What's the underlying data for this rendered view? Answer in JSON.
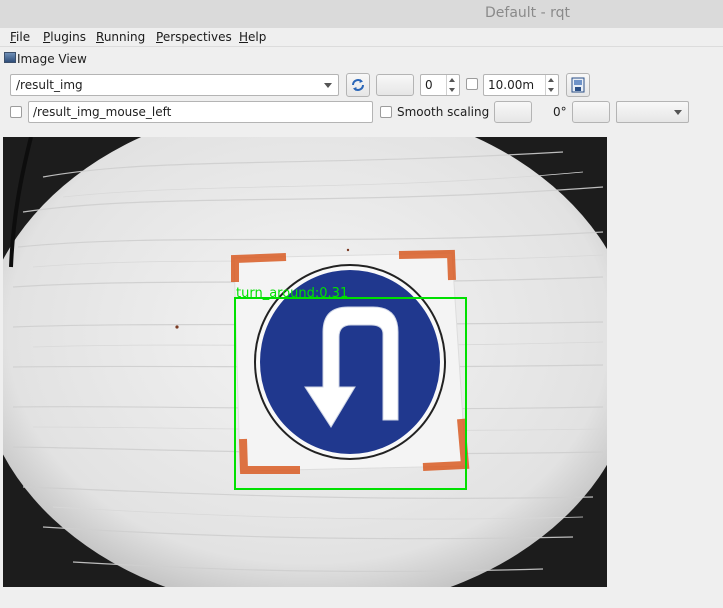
{
  "window": {
    "title": "Default - rqt"
  },
  "menu": {
    "file": "File",
    "plugins": "Plugins",
    "running": "Running",
    "perspectives": "Perspectives",
    "help": "Help"
  },
  "dock": {
    "title": "Image View",
    "icon": "image-view-icon"
  },
  "toolbar": {
    "topic_combo": "/result_img",
    "refresh_icon": "refresh-icon",
    "zoom_value": "0",
    "rate_value": "10.00m",
    "save_icon": "save-image-icon"
  },
  "toolbar2": {
    "mouse_topic": "/result_img_mouse_left",
    "smooth_label": "Smooth scaling",
    "rotation_label": "0°"
  },
  "image": {
    "detection_label": "turn_around:0.31",
    "box_color": "#00e000",
    "sign_color": "#20388e"
  }
}
